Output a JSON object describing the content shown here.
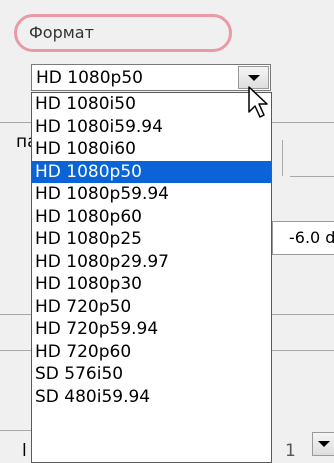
{
  "format_label": "Формат",
  "combo": {
    "value": "HD 1080p50"
  },
  "dropdown": {
    "items": [
      "HD 1080i50",
      "HD 1080i59.94",
      "HD 1080i60",
      "HD 1080p50",
      "HD 1080p59.94",
      "HD 1080p60",
      "HD 1080p25",
      "HD 1080p29.97",
      "HD 1080p30",
      "HD 720p50",
      "HD 720p59.94",
      "HD 720p60",
      "SD 576i50",
      "SD 480i59.94"
    ],
    "selected_index": 3
  },
  "background": {
    "fragment_left_1": "па",
    "fragment_left_2": "l",
    "field_value": "-6.0 d",
    "fragment_right_bottom": "1"
  },
  "colors": {
    "selection": "#0a64d8",
    "highlight_border": "#e89aa5"
  }
}
